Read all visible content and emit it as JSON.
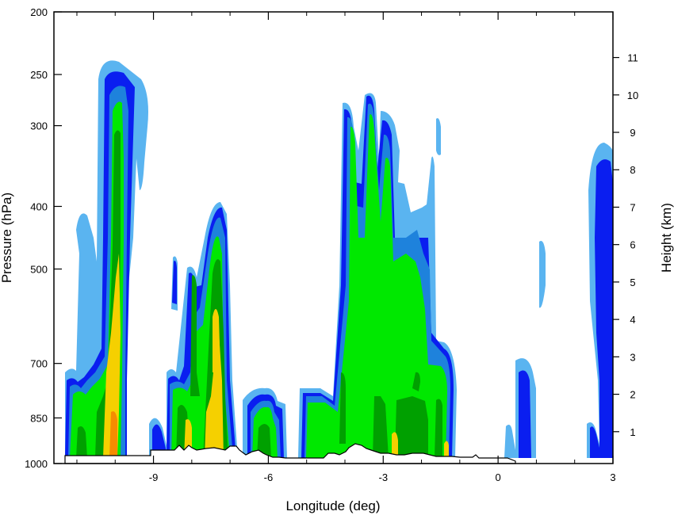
{
  "chart_data": {
    "type": "heatmap",
    "subtype": "filled-contour cross-section",
    "xlabel": "Longitude (deg)",
    "ylabel_left": "Pressure (hPa)",
    "ylabel_right": "Height (km)",
    "xlim": [
      -11.6,
      3.0
    ],
    "pressure_lim": [
      1000,
      200
    ],
    "y_scale": "log",
    "x_ticks": [
      -9,
      -6,
      -3,
      0,
      3
    ],
    "x_tick_labels": [
      "-9",
      "-6",
      "-3",
      "0",
      "3"
    ],
    "pressure_ticks": [
      1000,
      850,
      700,
      500,
      400,
      300,
      250,
      200
    ],
    "pressure_tick_labels": [
      "1000",
      "850",
      "700",
      "500",
      "400",
      "300",
      "250",
      "200"
    ],
    "height_ticks_km": [
      1,
      2,
      3,
      4,
      5,
      6,
      7,
      8,
      9,
      10,
      11
    ],
    "height_tick_labels": [
      "1",
      "2",
      "3",
      "4",
      "5",
      "6",
      "7",
      "8",
      "9",
      "10",
      "11"
    ],
    "grid": false,
    "legend": "none",
    "contour_colors": [
      "#5ab4f0",
      "#0a1ef0",
      "#1e82dc",
      "#00e800",
      "#00a000",
      "#f5d000",
      "#f58c00"
    ],
    "terrain_fill": "#ffffff",
    "terrain_outline": "#000000",
    "features": [
      {
        "x_range": [
          -11.5,
          -9.1
        ],
        "top_pressure": 240,
        "max_level": 6
      },
      {
        "x_range": [
          -9.0,
          -6.9
        ],
        "top_pressure": 410,
        "max_level": 5
      },
      {
        "x_range": [
          -6.8,
          -5.6
        ],
        "top_pressure": 790,
        "max_level": 3
      },
      {
        "x_range": [
          -5.2,
          -1.2
        ],
        "top_pressure": 265,
        "max_level": 5
      },
      {
        "x_range": [
          0.2,
          1.2
        ],
        "top_pressure": 450,
        "max_level": 1
      },
      {
        "x_range": [
          2.3,
          3.0
        ],
        "top_pressure": 320,
        "max_level": 1
      }
    ]
  }
}
